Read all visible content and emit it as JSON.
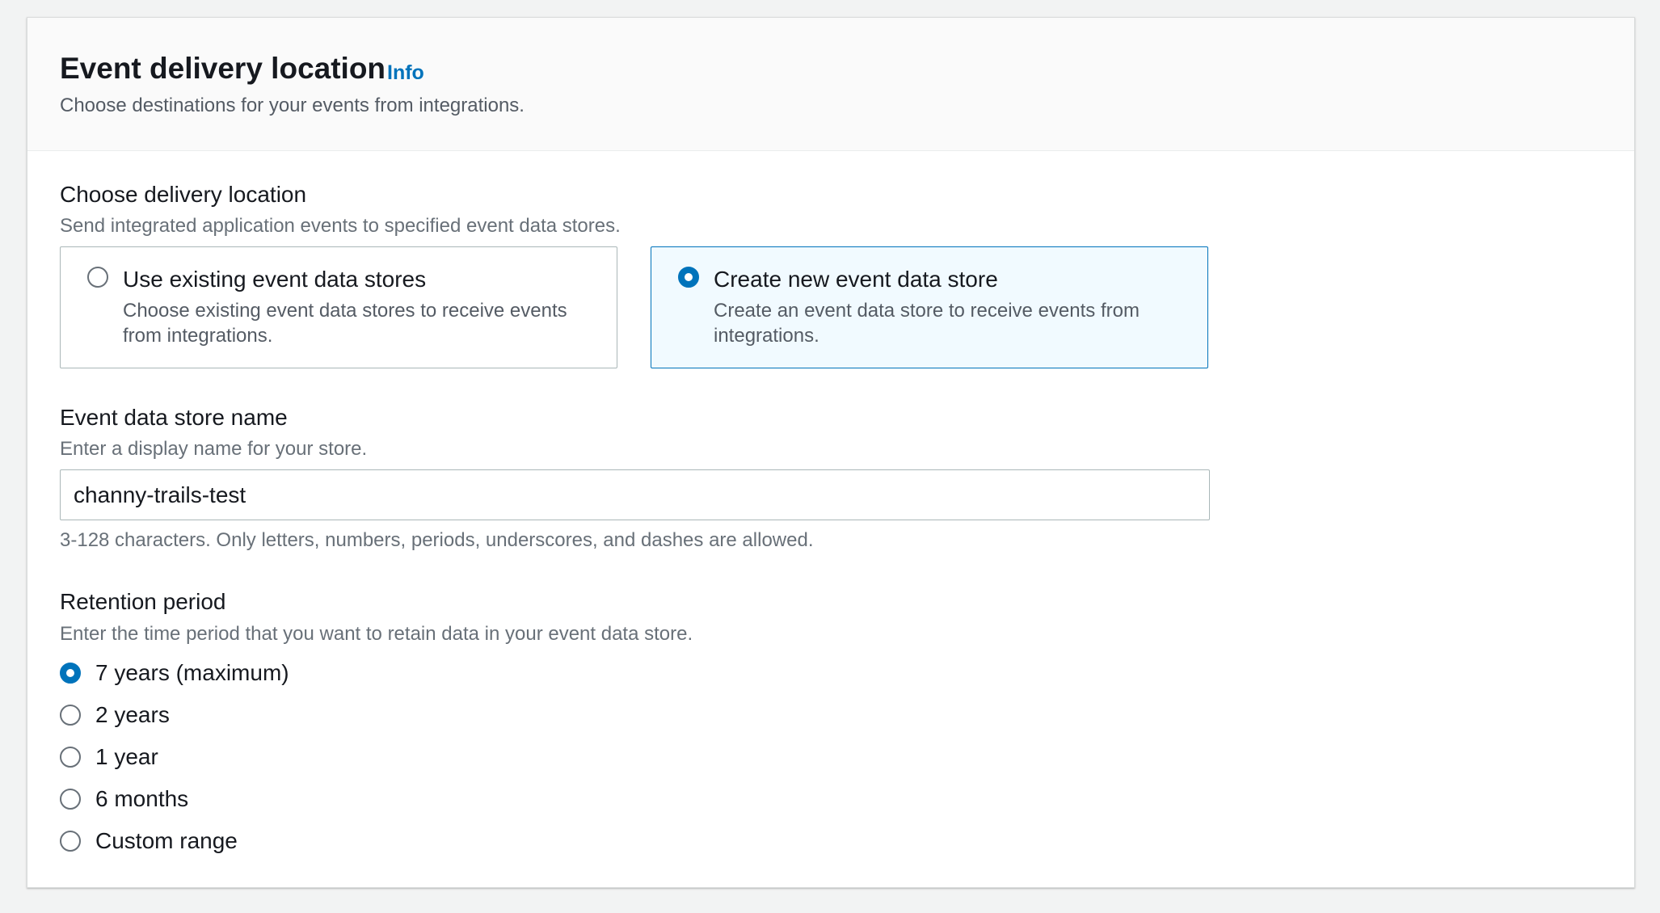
{
  "header": {
    "title": "Event delivery location",
    "info_link": "Info",
    "description": "Choose destinations for your events from integrations."
  },
  "delivery": {
    "label": "Choose delivery location",
    "description": "Send integrated application events to specified event data stores.",
    "options": [
      {
        "title": "Use existing event data stores",
        "description": "Choose existing event data stores to receive events from integrations.",
        "selected": false
      },
      {
        "title": "Create new event data store",
        "description": "Create an event data store to receive events from integrations.",
        "selected": true
      }
    ]
  },
  "store_name": {
    "label": "Event data store name",
    "description": "Enter a display name for your store.",
    "value": "channy-trails-test",
    "constraint": "3-128 characters. Only letters, numbers, periods, underscores, and dashes are allowed."
  },
  "retention": {
    "label": "Retention period",
    "description": "Enter the time period that you want to retain data in your event data store.",
    "options": [
      {
        "label": "7 years (maximum)",
        "selected": true
      },
      {
        "label": "2 years",
        "selected": false
      },
      {
        "label": "1 year",
        "selected": false
      },
      {
        "label": "6 months",
        "selected": false
      },
      {
        "label": "Custom range",
        "selected": false
      }
    ]
  },
  "colors": {
    "accent": "#0073bb",
    "selected_tile_bg": "#f1faff",
    "border": "#aab7b8",
    "text": "#16191f",
    "secondary_text": "#687078"
  }
}
